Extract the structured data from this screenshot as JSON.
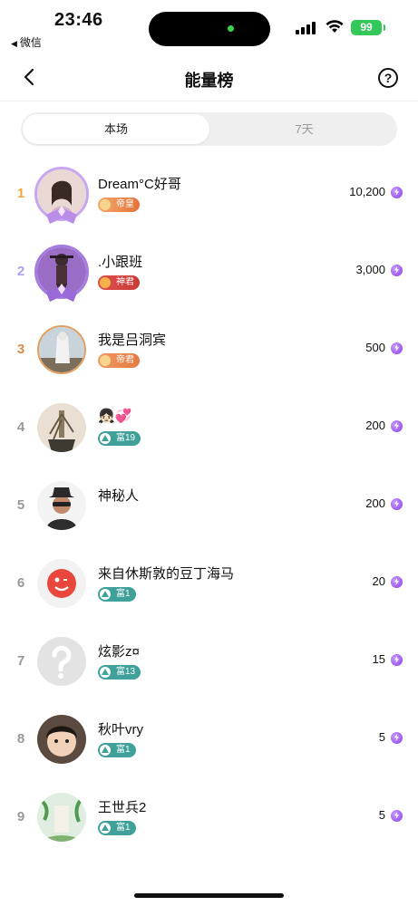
{
  "status_bar": {
    "time": "23:46",
    "back_app": "微信",
    "battery": "99"
  },
  "nav": {
    "title": "能量榜",
    "help": "?"
  },
  "tabs": [
    {
      "label": "本场",
      "active": true
    },
    {
      "label": "7天",
      "active": false
    }
  ],
  "ranking": [
    {
      "rank": "1",
      "name": "Dream°C好哥",
      "badge": "帝皇",
      "badge_type": "emperor",
      "score": "10,200"
    },
    {
      "rank": "2",
      "name": ".小跟班",
      "badge": "神君",
      "badge_type": "god",
      "score": "3,000"
    },
    {
      "rank": "3",
      "name": "我是吕洞宾",
      "badge": "帝君",
      "badge_type": "king",
      "score": "500"
    },
    {
      "rank": "4",
      "name": "👧🏻💞",
      "badge": "富19",
      "badge_type": "rich",
      "score": "200"
    },
    {
      "rank": "5",
      "name": "神秘人",
      "badge": "",
      "badge_type": "none",
      "score": "200"
    },
    {
      "rank": "6",
      "name": "来自休斯敦的豆丁海马",
      "badge": "富1",
      "badge_type": "rich",
      "score": "20"
    },
    {
      "rank": "7",
      "name": "炫影z¤",
      "badge": "富13",
      "badge_type": "rich",
      "score": "15"
    },
    {
      "rank": "8",
      "name": "秋叶vry",
      "badge": "富1",
      "badge_type": "rich",
      "score": "5"
    },
    {
      "rank": "9",
      "name": "王世兵2",
      "badge": "富1",
      "badge_type": "rich",
      "score": "5"
    }
  ],
  "colors": {
    "rank1": "#f0a93a",
    "rank2": "#a7a3e8",
    "rank3": "#d98a4a",
    "rank_other": "#999999",
    "energy_coin": "#8a3ee8",
    "rich_badge": "#3fa19a"
  },
  "icons": {
    "back": "chevron-left-icon",
    "help": "question-circle-icon",
    "energy": "lightning-coin-icon"
  }
}
